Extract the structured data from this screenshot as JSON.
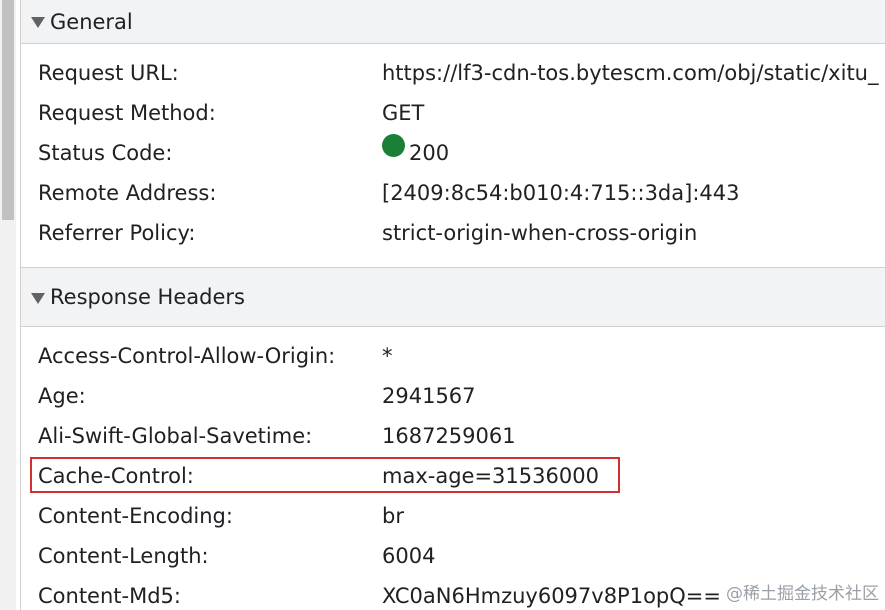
{
  "general": {
    "title": "General",
    "rows": [
      {
        "key": "Request URL:",
        "value": "https://lf3-cdn-tos.bytescm.com/obj/static/xitu_"
      },
      {
        "key": "Request Method:",
        "value": "GET"
      },
      {
        "key": "Status Code:",
        "value": "200"
      },
      {
        "key": "Remote Address:",
        "value": "[2409:8c54:b010:4:715::3da]:443"
      },
      {
        "key": "Referrer Policy:",
        "value": "strict-origin-when-cross-origin"
      }
    ]
  },
  "response_headers": {
    "title": "Response Headers",
    "rows": [
      {
        "key": "Access-Control-Allow-Origin:",
        "value": "*"
      },
      {
        "key": "Age:",
        "value": "2941567"
      },
      {
        "key": "Ali-Swift-Global-Savetime:",
        "value": "1687259061"
      },
      {
        "key": "Cache-Control:",
        "value": "max-age=31536000"
      },
      {
        "key": "Content-Encoding:",
        "value": "br"
      },
      {
        "key": "Content-Length:",
        "value": "6004"
      },
      {
        "key": "Content-Md5:",
        "value": "XC0aN6Hmzuy6097v8P1opQ=="
      }
    ]
  },
  "watermark": "@稀土掘金技术社区",
  "colors": {
    "status_ok": "#1a7f37",
    "highlight": "#d32f2f"
  }
}
